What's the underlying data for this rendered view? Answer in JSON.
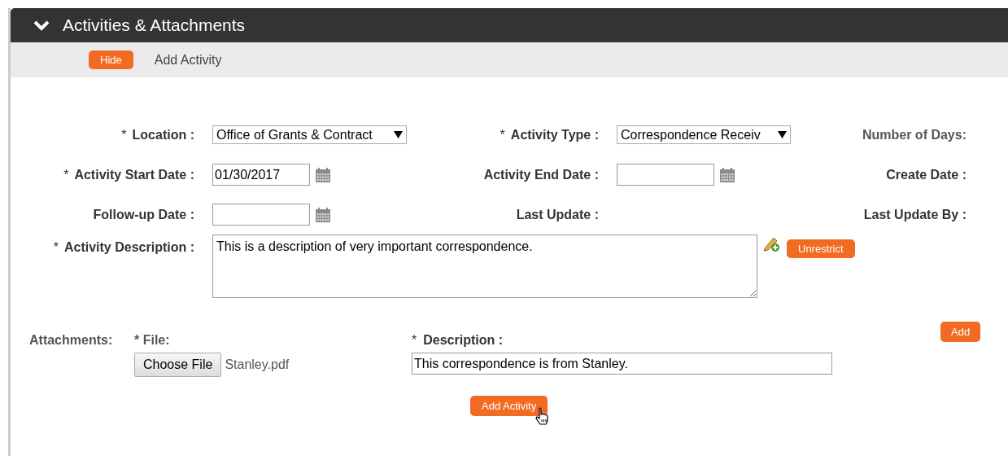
{
  "panel": {
    "title": "Activities & Attachments",
    "expanded": true
  },
  "toolbar": [
    {
      "kind": "button",
      "label": "Hide"
    },
    {
      "kind": "link",
      "label": "Add Activity"
    }
  ],
  "form_rows": [
    [
      {
        "mark": "*",
        "label": "Location :",
        "kind": "select",
        "value": "Office of Grants & Contract"
      },
      {
        "mark": "*",
        "label": "Activity Type :",
        "kind": "select",
        "value": "Correspondence Receiv"
      },
      {
        "label": "Number of Days:",
        "kind": "readonly",
        "muted": true
      }
    ],
    [
      {
        "mark": "*",
        "label": "Activity Start Date :",
        "kind": "date",
        "value": "01/30/2017"
      },
      {
        "label": "Activity End Date :",
        "kind": "date"
      },
      {
        "label": "Create Date :",
        "kind": "readonly"
      }
    ],
    [
      {
        "label": "Follow-up Date :",
        "kind": "date"
      },
      {
        "label": "Last Update :",
        "kind": "readonly"
      },
      {
        "label": "Last Update By :",
        "kind": "readonly"
      }
    ]
  ],
  "description": {
    "mark": "*",
    "label": "Activity Description :",
    "value": "This is a description of very important correspondence.",
    "button": "Unrestrict"
  },
  "attachments": {
    "label": "Attachments:",
    "file_label": "* File:",
    "choose_button": "Choose File",
    "file_name": "Stanley.pdf",
    "desc_mark": "*",
    "desc_label": "Description :",
    "desc_value": "This correspondence is from Stanley.",
    "add_button": "Add"
  },
  "submit_button": "Add Activity"
}
